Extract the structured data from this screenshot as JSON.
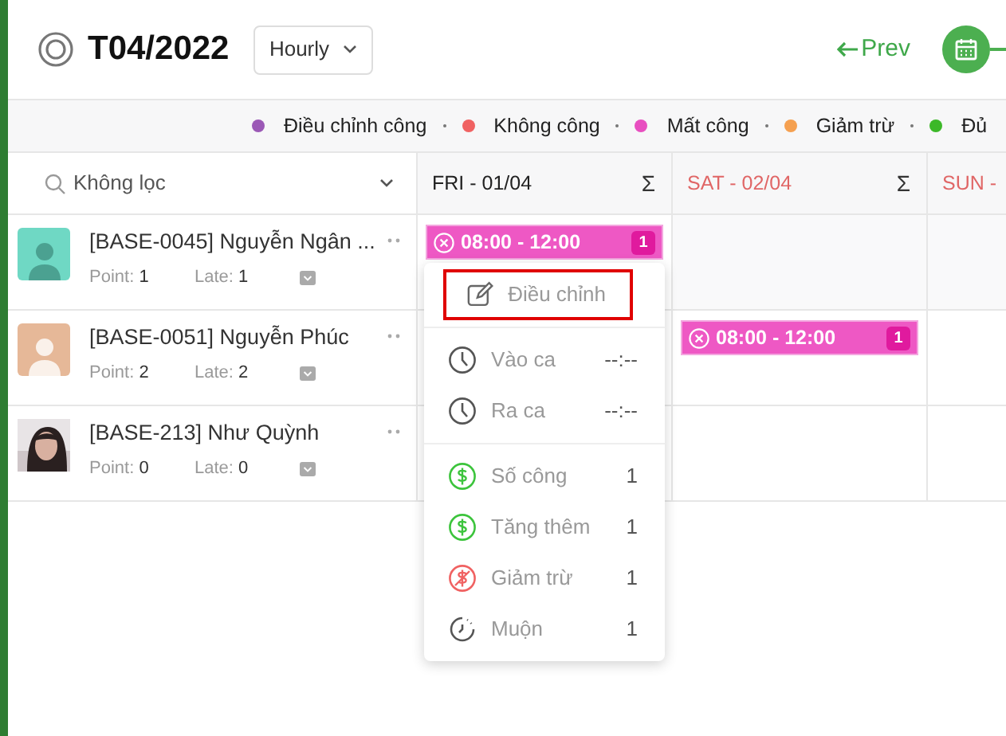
{
  "header": {
    "title": "T04/2022",
    "view_select": "Hourly",
    "prev": "Prev"
  },
  "legend": [
    {
      "label": "Điều chỉnh công",
      "color": "#9b59b6"
    },
    {
      "label": "Không công",
      "color": "#f06262"
    },
    {
      "label": "Mất công",
      "color": "#e84fc0"
    },
    {
      "label": "Giảm trừ",
      "color": "#f5a050"
    },
    {
      "label": "Đủ",
      "color": "#3cb828"
    }
  ],
  "filter": {
    "placeholder": "Không lọc"
  },
  "days": [
    {
      "label": "FRI - 01/04",
      "weekend": false,
      "sum": "Σ"
    },
    {
      "label": "SAT - 02/04",
      "weekend": true,
      "sum": "Σ"
    },
    {
      "label": "SUN -",
      "weekend": true
    }
  ],
  "employees": [
    {
      "name": "[BASE-0045] Nguyễn Ngân ...",
      "avatar": {
        "kind": "icon",
        "color": "#6fd8c4"
      },
      "point_label": "Point:",
      "point": "1",
      "late_label": "Late:",
      "late": "1",
      "cells": [
        {
          "shift": {
            "time": "08:00 - 12:00",
            "count": "1"
          }
        },
        {},
        {}
      ]
    },
    {
      "name": "[BASE-0051] Nguyễn Phúc",
      "avatar": {
        "kind": "icon",
        "color": "#e6b898"
      },
      "point_label": "Point:",
      "point": "2",
      "late_label": "Late:",
      "late": "2",
      "cells": [
        {},
        {
          "shift": {
            "time": "08:00 - 12:00",
            "count": "1"
          }
        },
        {}
      ]
    },
    {
      "name": "[BASE-213] Như Quỳnh",
      "avatar": {
        "kind": "picture"
      },
      "point_label": "Point:",
      "point": "0",
      "late_label": "Late:",
      "late": "0",
      "cells": [
        {},
        {},
        {}
      ]
    }
  ],
  "menu": {
    "sections": [
      {
        "items": [
          {
            "kind": "edit",
            "label": "Điều chỉnh",
            "highlighted": true
          }
        ]
      },
      {
        "items": [
          {
            "kind": "clock",
            "label": "Vào ca",
            "value": "--:--",
            "highlighted": false
          },
          {
            "kind": "clock",
            "label": "Ra ca",
            "value": "--:--",
            "highlighted": false
          }
        ]
      },
      {
        "items": [
          {
            "kind": "money",
            "label": "Số công",
            "value": "1",
            "highlighted": false
          },
          {
            "kind": "money",
            "label": "Tăng thêm",
            "value": "1",
            "highlighted": false
          },
          {
            "kind": "money_off",
            "label": "Giảm trừ",
            "value": "1",
            "highlighted": false
          },
          {
            "kind": "late",
            "label": "Muộn",
            "value": "1",
            "highlighted": false
          }
        ]
      }
    ]
  }
}
